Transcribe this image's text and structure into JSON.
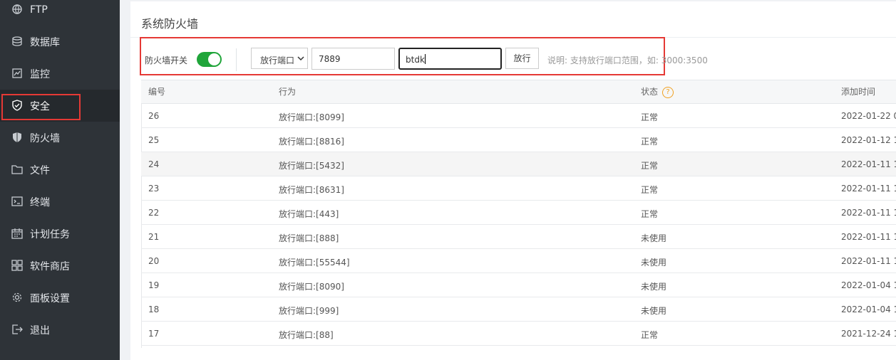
{
  "sidebar": {
    "items": [
      {
        "label": "FTP",
        "icon": "ftp-icon"
      },
      {
        "label": "数据库",
        "icon": "database-icon"
      },
      {
        "label": "监控",
        "icon": "monitor-icon"
      },
      {
        "label": "安全",
        "icon": "shield-check-icon"
      },
      {
        "label": "防火墙",
        "icon": "firewall-shield-icon"
      },
      {
        "label": "文件",
        "icon": "folder-icon"
      },
      {
        "label": "终端",
        "icon": "terminal-icon"
      },
      {
        "label": "计划任务",
        "icon": "calendar-icon"
      },
      {
        "label": "软件商店",
        "icon": "grid-icon"
      },
      {
        "label": "面板设置",
        "icon": "gear-icon"
      },
      {
        "label": "退出",
        "icon": "logout-icon"
      }
    ]
  },
  "panel": {
    "title": "系统防火墙"
  },
  "toolbar": {
    "firewall_switch_label": "防火墙开关",
    "firewall_on": true,
    "type_select": "放行端口",
    "port_value": "7889",
    "note_value": "btdk",
    "allow_button": "放行",
    "hint": "说明: 支持放行端口范围，如: 3000:3500"
  },
  "table": {
    "headers": [
      "编号",
      "行为",
      "状态",
      "添加时间"
    ],
    "rows": [
      {
        "id": "26",
        "action": "放行端口:[8099]",
        "status": "正常",
        "time": "2022-01-22 0"
      },
      {
        "id": "25",
        "action": "放行端口:[8816]",
        "status": "正常",
        "time": "2022-01-12 1"
      },
      {
        "id": "24",
        "action": "放行端口:[5432]",
        "status": "正常",
        "time": "2022-01-11 1"
      },
      {
        "id": "23",
        "action": "放行端口:[8631]",
        "status": "正常",
        "time": "2022-01-11 1"
      },
      {
        "id": "22",
        "action": "放行端口:[443]",
        "status": "正常",
        "time": "2022-01-11 1"
      },
      {
        "id": "21",
        "action": "放行端口:[888]",
        "status": "未使用",
        "time": "2022-01-11 1"
      },
      {
        "id": "20",
        "action": "放行端口:[55544]",
        "status": "未使用",
        "time": "2022-01-11 1"
      },
      {
        "id": "19",
        "action": "放行端口:[8090]",
        "status": "未使用",
        "time": "2022-01-04 1"
      },
      {
        "id": "18",
        "action": "放行端口:[999]",
        "status": "未使用",
        "time": "2022-01-04 1"
      },
      {
        "id": "17",
        "action": "放行端口:[88]",
        "status": "正常",
        "time": "2021-12-24 1"
      }
    ]
  },
  "colors": {
    "accent": "#20a53a",
    "highlight": "#e53935",
    "sidebar": "#2e3338"
  }
}
